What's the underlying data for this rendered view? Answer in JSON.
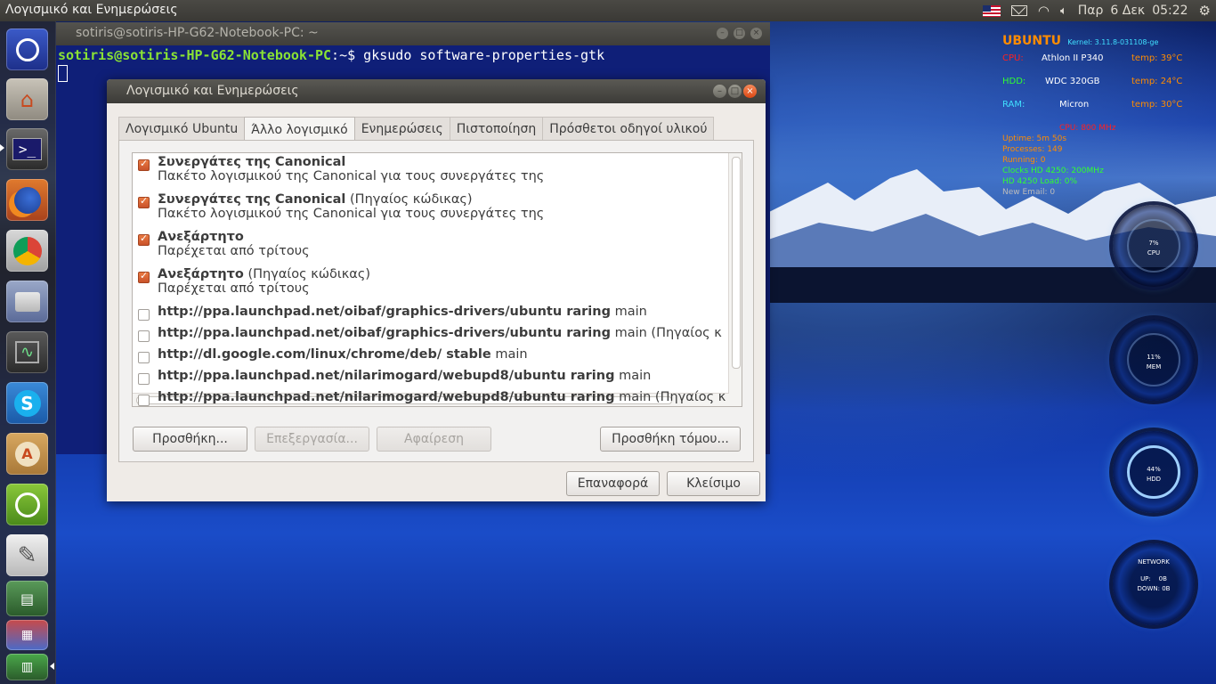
{
  "top_panel": {
    "title": "Λογισμικό και Ενημερώσεις",
    "day": "Παρ",
    "date": "6 Δεκ",
    "time": "05:22",
    "icons": [
      "us-flag-icon",
      "mail-icon",
      "wifi-icon",
      "volume-icon",
      "settings-gear-icon"
    ]
  },
  "launcher": {
    "items": [
      "ubuntu-dash",
      "home-folder",
      "terminal",
      "firefox",
      "chrome",
      "drive",
      "system-monitor",
      "skype",
      "software-updater",
      "ubuntu-software-center",
      "text-editor",
      "stack-1",
      "stack-2",
      "stack-3"
    ]
  },
  "terminal": {
    "title": "sotiris@sotiris-HP-G62-Notebook-PC: ~",
    "prompt_user": "sotiris@sotiris-HP-G62-Notebook-PC",
    "prompt_sep": ":~$ ",
    "command": "gksudo software-properties-gtk"
  },
  "dialog": {
    "title": "Λογισμικό και Ενημερώσεις",
    "tabs": [
      "Λογισμικό Ubuntu",
      "Άλλο λογισμικό",
      "Ενημερώσεις",
      "Πιστοποίηση",
      "Πρόσθετοι οδηγοί υλικού"
    ],
    "active_tab": "Άλλο λογισμικό",
    "sources": [
      {
        "checked": true,
        "bold": "Συνεργάτες της Canonical",
        "extra": "",
        "sub": "Πακέτο λογισμικού της Canonical για τους συνεργάτες της"
      },
      {
        "checked": true,
        "bold": "Συνεργάτες της Canonical",
        "extra": " (Πηγαίος κώδικας)",
        "sub": "Πακέτο λογισμικού της Canonical για τους συνεργάτες της"
      },
      {
        "checked": true,
        "bold": "Ανεξάρτητο",
        "extra": "",
        "sub": "Παρέχεται από τρίτους"
      },
      {
        "checked": true,
        "bold": "Ανεξάρτητο",
        "extra": " (Πηγαίος κώδικας)",
        "sub": "Παρέχεται από τρίτους"
      },
      {
        "checked": false,
        "bold": "http://ppa.launchpad.net/oibaf/graphics-drivers/ubuntu raring",
        "extra": " main",
        "sub": ""
      },
      {
        "checked": false,
        "bold": "http://ppa.launchpad.net/oibaf/graphics-drivers/ubuntu raring",
        "extra": " main (Πηγαίος κ",
        "sub": ""
      },
      {
        "checked": false,
        "bold": "http://dl.google.com/linux/chrome/deb/ stable",
        "extra": " main",
        "sub": ""
      },
      {
        "checked": false,
        "bold": "http://ppa.launchpad.net/nilarimogard/webupd8/ubuntu raring",
        "extra": " main",
        "sub": ""
      },
      {
        "checked": false,
        "bold": "http://ppa.launchpad.net/nilarimogard/webupd8/ubuntu raring",
        "extra": " main (Πηγαίος κ",
        "sub": ""
      }
    ],
    "buttons": {
      "add": "Προσθήκη...",
      "edit": "Επεξεργασία...",
      "remove": "Αφαίρεση",
      "add_volume": "Προσθήκη τόμου...",
      "revert": "Επαναφορά",
      "close": "Κλείσιμο"
    }
  },
  "conky": {
    "os": "UBUNTU",
    "kernel": "Kernel: 3.11.8-031108-ge",
    "cpu_label": "CPU:",
    "cpu_model": "Athlon II P340",
    "cpu_temp": "temp: 39°C",
    "hdd_label": "HDD:",
    "hdd_model": "WDC 320GB",
    "hdd_temp": "temp: 24°C",
    "ram_label": "RAM:",
    "ram_model": "Micron",
    "ram_temp": "temp: 30°C",
    "cpu_freq": "CPU: 800 MHz",
    "uptime": "Uptime: 5m 50s",
    "processes": "Processes: 149",
    "running": "Running: 0",
    "clocks": "Clocks HD 4250: 200MHz",
    "hd_load": "HD 4250 Load: 0%",
    "new_email": "New Email: 0",
    "ring_cpu": "7%",
    "ring_cpu_label": "CPU",
    "ring_mem": "11%",
    "ring_mem_label": "MEM",
    "ring_hdd": "44%",
    "ring_hdd_label": "HDD",
    "net_title": "NETWORK",
    "net_up": "UP:    0B",
    "net_down": "DOWN: 0B",
    "colors": {
      "orange": "#ff8c00",
      "red": "#ff2020",
      "green": "#30ff30",
      "cyan": "#40e0ff"
    }
  }
}
